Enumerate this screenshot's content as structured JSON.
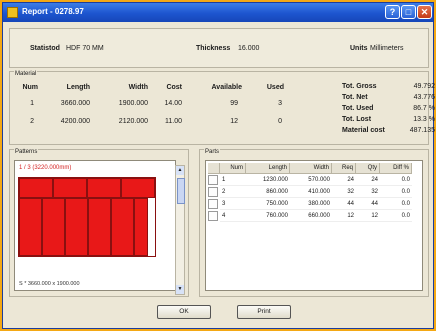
{
  "window": {
    "title": "Report - 0278.97",
    "help_glyph": "?",
    "max_glyph": "□",
    "close_glyph": "✕"
  },
  "info": {
    "material_label": "Statistod",
    "material_value": "HDF 70 MM",
    "thickness_label": "Thickness",
    "thickness_value": "16.000",
    "units_label": "Units",
    "units_value": "Millimeters"
  },
  "material": {
    "group_title": "Material",
    "headers": [
      "Num",
      "Length",
      "Width",
      "Cost",
      "Available",
      "Used"
    ],
    "rows": [
      [
        "1",
        "3660.000",
        "1900.000",
        "14.00",
        "99",
        "3"
      ],
      [
        "2",
        "4200.000",
        "2120.000",
        "11.00",
        "12",
        "0"
      ]
    ]
  },
  "stats": [
    {
      "label": "Tot. Gross",
      "value": "49.792"
    },
    {
      "label": "Tot. Net",
      "value": "43.776"
    },
    {
      "label": "Tot. Used",
      "value": "86.7 %"
    },
    {
      "label": "Tot. Lost",
      "value": "13.3 %"
    },
    {
      "label": "Material cost",
      "value": "487.135"
    }
  ],
  "patterns": {
    "group_title": "Patterns",
    "caption": "1 / 3   (3220.000mm)",
    "footer": "S * 3660.000 x 1900.000"
  },
  "parts": {
    "group_title": "Parts",
    "headers": [
      "Num",
      "Length",
      "Width",
      "Req",
      "Qty",
      "Diff %"
    ],
    "rows": [
      [
        "1",
        "1230.000",
        "570.000",
        "24",
        "24",
        "0.0"
      ],
      [
        "2",
        "860.000",
        "410.000",
        "32",
        "32",
        "0.0"
      ],
      [
        "3",
        "750.000",
        "380.000",
        "44",
        "44",
        "0.0"
      ],
      [
        "4",
        "760.000",
        "660.000",
        "12",
        "12",
        "0.0"
      ]
    ]
  },
  "buttons": {
    "ok": "OK",
    "print": "Print"
  },
  "colors": {
    "titlebar": "#1d55cf",
    "piece_fill": "#e81818",
    "desktop": "#f4a814"
  }
}
